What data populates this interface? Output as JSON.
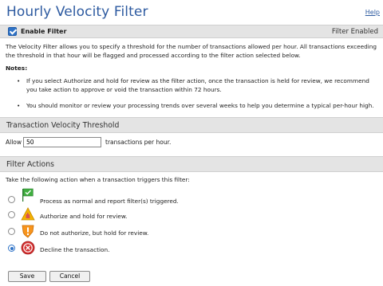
{
  "header": {
    "title": "Hourly Velocity Filter",
    "help_label": "Help"
  },
  "enable": {
    "checked": true,
    "label": "Enable Filter",
    "status": "Filter Enabled"
  },
  "description": "The Velocity Filter allows you to specify a threshold for the number of transactions allowed per hour. All transactions exceeding the threshold in that hour will be flagged and processed according to the filter action selected below.",
  "notes": {
    "heading": "Notes:",
    "items": [
      "If you select Authorize and hold for review as the filter action, once the transaction is held for review, we recommend you take action to approve or void the transaction within 72 hours.",
      "You should monitor or review your processing trends over several weeks to help you determine a typical per-hour high."
    ]
  },
  "velocity": {
    "section_title": "Transaction Velocity Threshold",
    "allow_label": "Allow",
    "value": "50",
    "suffix": "transactions per hour."
  },
  "actions": {
    "section_title": "Filter Actions",
    "intro": "Take the following action when a transaction triggers this filter:",
    "options": [
      {
        "label": "Process as normal and report filter(s) triggered.",
        "icon": "green-flag-icon",
        "selected": false
      },
      {
        "label": "Authorize and hold for review.",
        "icon": "warning-hand-icon",
        "selected": false
      },
      {
        "label": "Do not authorize, but hold for review.",
        "icon": "exclamation-shield-icon",
        "selected": false
      },
      {
        "label": "Decline the transaction.",
        "icon": "decline-x-icon",
        "selected": true
      }
    ]
  },
  "buttons": {
    "save": "Save",
    "cancel": "Cancel"
  },
  "colors": {
    "title": "#2d5aa0",
    "accent": "#2f73c7",
    "section_bg": "#e4e4e4"
  }
}
